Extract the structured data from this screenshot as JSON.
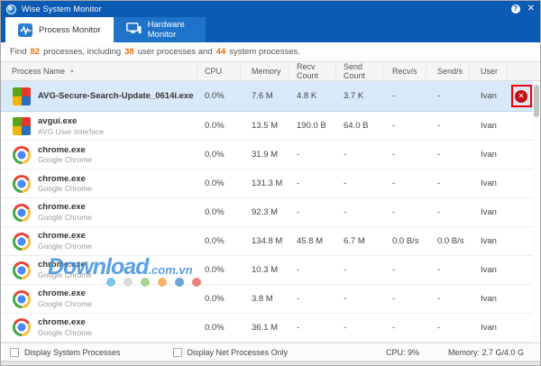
{
  "window": {
    "title": "Wise System Monitor"
  },
  "titlebar": {
    "help_glyph": "?",
    "close_glyph": "✕"
  },
  "tabs": [
    {
      "label": "Process Monitor",
      "active": true
    },
    {
      "label": "Hardware Monitor",
      "active": false
    }
  ],
  "summary": {
    "prefix": "Find",
    "total": "82",
    "mid1": "processes, including",
    "user_count": "38",
    "mid2": "user processes and",
    "system_count": "44",
    "suffix": "system processes."
  },
  "table": {
    "columns": {
      "name": "Process Name",
      "cpu": "CPU",
      "memory": "Memory",
      "recv_count": "Recv Count",
      "send_count": "Send Count",
      "recv_s": "Recv/s",
      "send_s": "Send/s",
      "user": "User"
    },
    "sort_indicator": "▲",
    "rows": [
      {
        "name": "AVG-Secure-Search-Update_0614i.exe",
        "desc": "",
        "icon": "avg",
        "cpu": "0.0%",
        "memory": "7.6 M",
        "recv_count": "4.8 K",
        "send_count": "3.7 K",
        "recv_s": "-",
        "send_s": "-",
        "user": "Ivan",
        "highlighted": true,
        "kill_glyph": "✕"
      },
      {
        "name": "avgui.exe",
        "desc": "AVG User Interface",
        "icon": "avg",
        "cpu": "0.0%",
        "memory": "13.5 M",
        "recv_count": "190.0 B",
        "send_count": "64.0 B",
        "recv_s": "-",
        "send_s": "-",
        "user": "Ivan",
        "highlighted": false
      },
      {
        "name": "chrome.exe",
        "desc": "Google Chrome",
        "icon": "chrome",
        "cpu": "0.0%",
        "memory": "31.9 M",
        "recv_count": "-",
        "send_count": "-",
        "recv_s": "-",
        "send_s": "-",
        "user": "Ivan",
        "highlighted": false
      },
      {
        "name": "chrome.exe",
        "desc": "Google Chrome",
        "icon": "chrome",
        "cpu": "0.0%",
        "memory": "131.3 M",
        "recv_count": "-",
        "send_count": "-",
        "recv_s": "-",
        "send_s": "-",
        "user": "Ivan",
        "highlighted": false
      },
      {
        "name": "chrome.exe",
        "desc": "Google Chrome",
        "icon": "chrome",
        "cpu": "0.0%",
        "memory": "92.3 M",
        "recv_count": "-",
        "send_count": "-",
        "recv_s": "-",
        "send_s": "-",
        "user": "Ivan",
        "highlighted": false
      },
      {
        "name": "chrome.exe",
        "desc": "Google Chrome",
        "icon": "chrome",
        "cpu": "0.0%",
        "memory": "134.8 M",
        "recv_count": "45.8 M",
        "send_count": "6.7 M",
        "recv_s": "0.0 B/s",
        "send_s": "0.0 B/s",
        "user": "Ivan",
        "highlighted": false
      },
      {
        "name": "chrome.exe",
        "desc": "Google Chrome",
        "icon": "chrome",
        "cpu": "0.0%",
        "memory": "10.3 M",
        "recv_count": "-",
        "send_count": "-",
        "recv_s": "-",
        "send_s": "-",
        "user": "Ivan",
        "highlighted": false
      },
      {
        "name": "chrome.exe",
        "desc": "Google Chrome",
        "icon": "chrome",
        "cpu": "0.0%",
        "memory": "3.8 M",
        "recv_count": "-",
        "send_count": "-",
        "recv_s": "-",
        "send_s": "-",
        "user": "Ivan",
        "highlighted": false
      },
      {
        "name": "chrome.exe",
        "desc": "Google Chrome",
        "icon": "chrome",
        "cpu": "0.0%",
        "memory": "36.1 M",
        "recv_count": "-",
        "send_count": "-",
        "recv_s": "-",
        "send_s": "-",
        "user": "Ivan",
        "highlighted": false
      }
    ]
  },
  "statusbar": {
    "checkbox_system": "Display System Processes",
    "checkbox_net": "Display Net Processes Only",
    "cpu": "CPU: 9%",
    "memory": "Memory: 2.7 G/4.0 G"
  },
  "watermark": {
    "text_main": "Download",
    "text_suffix": ".com.vn",
    "dot_colors": [
      "#7ec3ea",
      "#d9d9d9",
      "#a5d68d",
      "#f2b566",
      "#6aa3d8",
      "#ef8080"
    ]
  },
  "colors": {
    "titlebar_blue": "#0b5ab4",
    "inactive_tab_blue": "#1e73c9",
    "highlight_row": "#d8eaf9",
    "accent_orange": "#e8700a",
    "kill_red": "#c40f0f",
    "annotation_red": "#f20000"
  }
}
